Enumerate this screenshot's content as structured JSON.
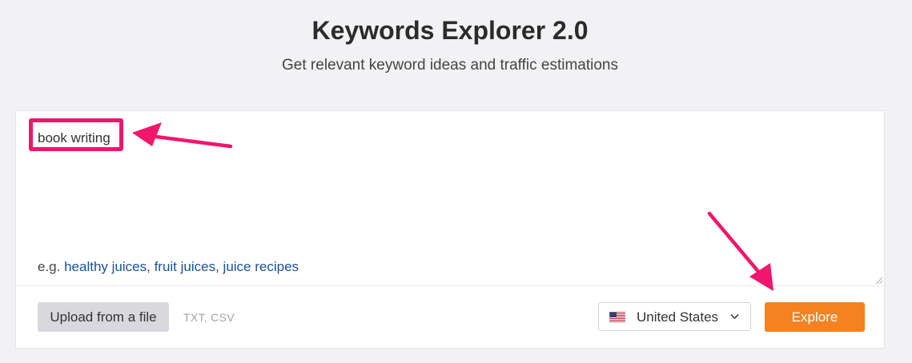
{
  "header": {
    "title": "Keywords Explorer 2.0",
    "subtitle": "Get relevant keyword ideas and traffic estimations"
  },
  "keywords": {
    "value": "book writing",
    "examples_prefix": "e.g.",
    "examples": [
      "healthy juices",
      "fruit juices",
      "juice recipes"
    ],
    "separator": ", "
  },
  "upload": {
    "label": "Upload from a file",
    "file_types": "TXT, CSV"
  },
  "country": {
    "selected": "United States",
    "flag_icon": "us-flag-icon"
  },
  "explore": {
    "label": "Explore"
  },
  "colors": {
    "accent": "#f58220",
    "annotation": "#f0166b",
    "link": "#1a5299"
  }
}
